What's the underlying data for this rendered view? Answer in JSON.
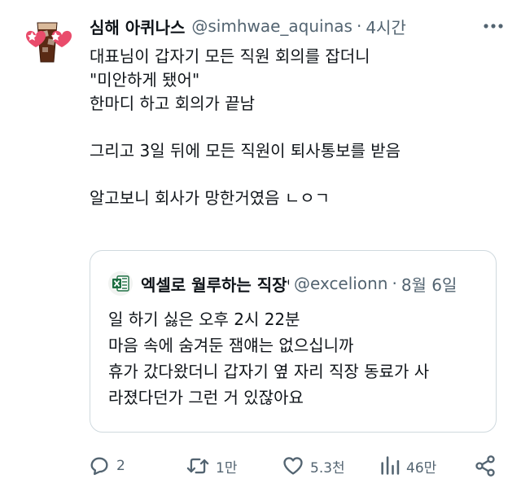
{
  "author": {
    "name": "심해 아퀴나스",
    "handle": "@simhwae_aquinas",
    "separator": "·",
    "time": "4시간"
  },
  "tweet": {
    "lines": [
      "대표님이 갑자기 모든 직원 회의를 잡더니",
      "\"미안하게 됐어\"",
      "한마디 하고 회의가 끝남",
      "",
      "그리고 3일 뒤에 모든 직원이 퇴사통보를 받음",
      "",
      "알고보니 회사가 망한거였음 ㄴㅇㄱ"
    ]
  },
  "quote": {
    "name": "엑셀로 월루하는 직장인",
    "handle": "@excelionn",
    "separator": "·",
    "time": "8월 6일",
    "lines": [
      "일 하기 싫은 오후 2시 22분",
      "마음 속에 숨겨둔 잼얘는 없으십니까",
      "휴가 갔다왔더니 갑자기 옆 자리 직장 동료가 사",
      "라졌다던가 그런 거 있잖아요"
    ]
  },
  "actions": {
    "replies": "2",
    "retweets": "1만",
    "likes": "5.3천",
    "views": "46만"
  },
  "icons": {
    "more": "more-dots-icon",
    "reply": "reply-bubble-icon",
    "retweet": "retweet-icon",
    "like": "heart-icon",
    "views": "views-bars-icon",
    "share": "share-icon",
    "quote_avatar": "excel-logo-icon"
  },
  "colors": {
    "text": "#0f1419",
    "secondary": "#536471",
    "border": "#cfd9de",
    "excel_green": "#1d6f42"
  }
}
